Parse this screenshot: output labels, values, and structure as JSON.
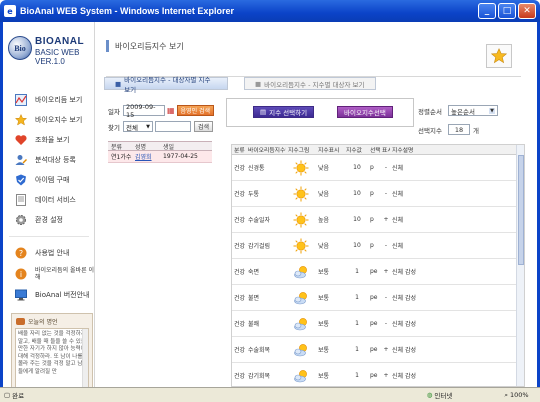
{
  "window": {
    "title": "BioAnal WEB System - Windows Internet Explorer",
    "minimize": "_",
    "maximize": "□",
    "close": "✕"
  },
  "logo": {
    "mark": "Bio",
    "brand": "BIOANAL",
    "version": "BASIC WEB VER.1.0"
  },
  "sidebar": {
    "items": [
      {
        "label": "바이오리듬 보기",
        "icon": "chart-line-icon"
      },
      {
        "label": "바이오지수 보기",
        "icon": "star-icon"
      },
      {
        "label": "조화율 보기",
        "icon": "heart-icon"
      },
      {
        "label": "분석대상 등록",
        "icon": "user-pencil-icon"
      },
      {
        "label": "아이템 구매",
        "icon": "shield-icon"
      },
      {
        "label": "데이터 서비스",
        "icon": "document-icon"
      },
      {
        "label": "환경 설정",
        "icon": "gear-icon"
      }
    ],
    "items2": [
      {
        "label": "사용법 안내",
        "icon": "question-icon"
      },
      {
        "label": "바이오리듬의 올바른 이해",
        "icon": "info-icon"
      },
      {
        "label": "BioAnal 버전안내",
        "icon": "monitor-icon"
      }
    ],
    "memo_title": "오늘의 명언",
    "memo_text": "배울 자리 없는 것을 걱정하지 말고, 배울 때 들을 쓸 수 있을 만한 자기가 하지 않아 능력에 대해 걱정하라. 또 남이 나를 몰라 주는 것을 걱정 말고 남들에게 알려질 만"
  },
  "page": {
    "title": "바이오리듬지수 보기",
    "tabs": [
      "바이오리듬지수 - 대상자별 지수 보기",
      "바이오리듬지수 - 지수별 대상자 보기"
    ],
    "date_label": "일자",
    "date_value": "2009-09-15",
    "search_date_button": "음영인 검색",
    "find_label": "찾기",
    "find_select": "전체",
    "find_input": "",
    "find_button": "검색",
    "mini_table": {
      "headers": [
        "분류",
        "성명",
        "생일"
      ],
      "rows": [
        [
          "연1가수",
          "김영희",
          "1977-04-25"
        ]
      ]
    },
    "select_index_button": "지수 선택하기",
    "bio_select_button": "바이오지수선택",
    "sort_label": "정렬순서",
    "sort_value": "높은순서",
    "select_index_label": "선택지수",
    "select_index_value": "18",
    "select_index_unit": "개"
  },
  "grid": {
    "headers": [
      "분류",
      "바이오리듬지수명",
      "지수그림",
      "지수표시",
      "지수값",
      "선택",
      "표시",
      "지수설명"
    ],
    "rows": [
      {
        "cat": "건강",
        "name": "신경통",
        "icon": "sun-icon",
        "mark": "낮음",
        "value": "10",
        "sel": "p",
        "sign": "-",
        "desc": "신체"
      },
      {
        "cat": "건강",
        "name": "두통",
        "icon": "sun-icon",
        "mark": "낮음",
        "value": "10",
        "sel": "p",
        "sign": "-",
        "desc": "신체"
      },
      {
        "cat": "건강",
        "name": "수술일자",
        "icon": "sun-icon",
        "mark": "높음",
        "value": "10",
        "sel": "p",
        "sign": "+",
        "desc": "신체"
      },
      {
        "cat": "건강",
        "name": "감기걸림",
        "icon": "sun-icon",
        "mark": "낮음",
        "value": "10",
        "sel": "p",
        "sign": "-",
        "desc": "신체"
      },
      {
        "cat": "건강",
        "name": "숙면",
        "icon": "cloud-sun-icon",
        "mark": "보통",
        "value": "1",
        "sel": "pe",
        "sign": "+",
        "desc": "신체 감성"
      },
      {
        "cat": "건강",
        "name": "불면",
        "icon": "cloud-sun-icon",
        "mark": "보통",
        "value": "1",
        "sel": "pe",
        "sign": "-",
        "desc": "신체 감성"
      },
      {
        "cat": "건강",
        "name": "불쾌",
        "icon": "cloud-sun-icon",
        "mark": "보통",
        "value": "1",
        "sel": "pe",
        "sign": "-",
        "desc": "신체 감성"
      },
      {
        "cat": "건강",
        "name": "수술회복",
        "icon": "cloud-sun-icon",
        "mark": "보통",
        "value": "1",
        "sel": "pe",
        "sign": "+",
        "desc": "신체 감성"
      },
      {
        "cat": "건강",
        "name": "감기회복",
        "icon": "cloud-sun-icon",
        "mark": "보통",
        "value": "1",
        "sel": "pe",
        "sign": "+",
        "desc": "신체 감성"
      }
    ]
  },
  "statusbar": {
    "left": "완료",
    "zone": "인터넷",
    "zoom": "100%"
  }
}
